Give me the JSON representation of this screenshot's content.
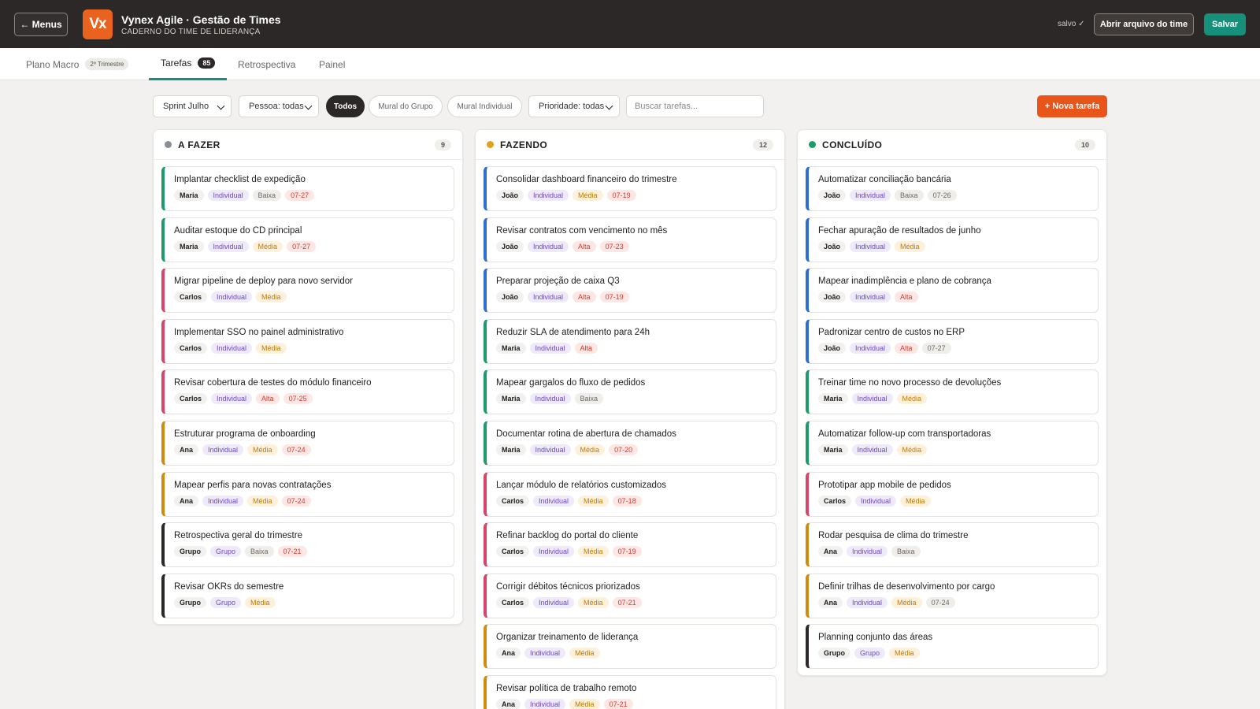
{
  "header": {
    "menus_button": "← Menus",
    "logo_text": "Vx",
    "title": "Vynex Agile · Gestão de Times",
    "subtitle": "CADERNO DO TIME DE LIDERANÇA",
    "saved_status": "salvo ✓",
    "open_file_button": "Abrir arquivo do time",
    "save_button": "Salvar"
  },
  "tabs": [
    {
      "label": "Plano Macro",
      "badge": "2º Trimestre",
      "active": false
    },
    {
      "label": "Tarefas",
      "badge": "85",
      "active": true
    },
    {
      "label": "Retrospectiva",
      "badge": "",
      "active": false
    },
    {
      "label": "Painel",
      "badge": "",
      "active": false
    }
  ],
  "filters": {
    "sprint": "Sprint Julho",
    "person": "Pessoa: todas",
    "chips": [
      "Todos",
      "Mural do Grupo",
      "Mural Individual"
    ],
    "priority": "Prioridade: todas",
    "search_placeholder": "Buscar tarefas...",
    "new_task_button": "+ Nova tarefa"
  },
  "colors": {
    "accent": "#16907a",
    "orange": "#e9541a",
    "people": {
      "Maria": "#1f9a6b",
      "Carlos": "#d8456b",
      "Ana": "#d18b0e",
      "Grupo": "#2b2827",
      "João": "#2d6fd0"
    }
  },
  "columns": [
    {
      "title": "A FAZER",
      "count": "9",
      "dot": "#8a8f96",
      "cards": [
        {
          "title": "Implantar checklist de expedição",
          "person": "Maria",
          "type": "Individual",
          "priority": "Baixa",
          "date": "07-27"
        },
        {
          "title": "Auditar estoque do CD principal",
          "person": "Maria",
          "type": "Individual",
          "priority": "Média",
          "date": "07-27"
        },
        {
          "title": "Migrar pipeline de deploy para novo servidor",
          "person": "Carlos",
          "type": "Individual",
          "priority": "Média",
          "date": ""
        },
        {
          "title": "Implementar SSO no painel administrativo",
          "person": "Carlos",
          "type": "Individual",
          "priority": "Média",
          "date": ""
        },
        {
          "title": "Revisar cobertura de testes do módulo financeiro",
          "person": "Carlos",
          "type": "Individual",
          "priority": "Alta",
          "date": "07-25"
        },
        {
          "title": "Estruturar programa de onboarding",
          "person": "Ana",
          "type": "Individual",
          "priority": "Média",
          "date": "07-24"
        },
        {
          "title": "Mapear perfis para novas contratações",
          "person": "Ana",
          "type": "Individual",
          "priority": "Média",
          "date": "07-24"
        },
        {
          "title": "Retrospectiva geral do trimestre",
          "person": "Grupo",
          "type": "Grupo",
          "priority": "Baixa",
          "date": "07-21"
        },
        {
          "title": "Revisar OKRs do semestre",
          "person": "Grupo",
          "type": "Grupo",
          "priority": "Média",
          "date": ""
        }
      ]
    },
    {
      "title": "FAZENDO",
      "count": "12",
      "dot": "#e2a11c",
      "cards": [
        {
          "title": "Consolidar dashboard financeiro do trimestre",
          "person": "João",
          "type": "Individual",
          "priority": "Média",
          "date": "07-19"
        },
        {
          "title": "Revisar contratos com vencimento no mês",
          "person": "João",
          "type": "Individual",
          "priority": "Alta",
          "date": "07-23"
        },
        {
          "title": "Preparar projeção de caixa Q3",
          "person": "João",
          "type": "Individual",
          "priority": "Alta",
          "date": "07-19"
        },
        {
          "title": "Reduzir SLA de atendimento para 24h",
          "person": "Maria",
          "type": "Individual",
          "priority": "Alta",
          "date": ""
        },
        {
          "title": "Mapear gargalos do fluxo de pedidos",
          "person": "Maria",
          "type": "Individual",
          "priority": "Baixa",
          "date": ""
        },
        {
          "title": "Documentar rotina de abertura de chamados",
          "person": "Maria",
          "type": "Individual",
          "priority": "Média",
          "date": "07-20"
        },
        {
          "title": "Lançar módulo de relatórios customizados",
          "person": "Carlos",
          "type": "Individual",
          "priority": "Média",
          "date": "07-18"
        },
        {
          "title": "Refinar backlog do portal do cliente",
          "person": "Carlos",
          "type": "Individual",
          "priority": "Média",
          "date": "07-19"
        },
        {
          "title": "Corrigir débitos técnicos priorizados",
          "person": "Carlos",
          "type": "Individual",
          "priority": "Média",
          "date": "07-21"
        },
        {
          "title": "Organizar treinamento de liderança",
          "person": "Ana",
          "type": "Individual",
          "priority": "Média",
          "date": ""
        },
        {
          "title": "Revisar política de trabalho remoto",
          "person": "Ana",
          "type": "Individual",
          "priority": "Média",
          "date": "07-21"
        }
      ]
    },
    {
      "title": "CONCLUÍDO",
      "count": "10",
      "dot": "#1f9a6b",
      "cards": [
        {
          "title": "Automatizar conciliação bancária",
          "person": "João",
          "type": "Individual",
          "priority": "Baixa",
          "date": "07-26"
        },
        {
          "title": "Fechar apuração de resultados de junho",
          "person": "João",
          "type": "Individual",
          "priority": "Média",
          "date": ""
        },
        {
          "title": "Mapear inadimplência e plano de cobrança",
          "person": "João",
          "type": "Individual",
          "priority": "Alta",
          "date": ""
        },
        {
          "title": "Padronizar centro de custos no ERP",
          "person": "João",
          "type": "Individual",
          "priority": "Alta",
          "date": "07-27"
        },
        {
          "title": "Treinar time no novo processo de devoluções",
          "person": "Maria",
          "type": "Individual",
          "priority": "Média",
          "date": ""
        },
        {
          "title": "Automatizar follow-up com transportadoras",
          "person": "Maria",
          "type": "Individual",
          "priority": "Média",
          "date": ""
        },
        {
          "title": "Prototipar app mobile de pedidos",
          "person": "Carlos",
          "type": "Individual",
          "priority": "Média",
          "date": ""
        },
        {
          "title": "Rodar pesquisa de clima do trimestre",
          "person": "Ana",
          "type": "Individual",
          "priority": "Baixa",
          "date": ""
        },
        {
          "title": "Definir trilhas de desenvolvimento por cargo",
          "person": "Ana",
          "type": "Individual",
          "priority": "Média",
          "date": "07-24"
        },
        {
          "title": "Planning conjunto das áreas",
          "person": "Grupo",
          "type": "Grupo",
          "priority": "Média",
          "date": ""
        }
      ]
    }
  ]
}
